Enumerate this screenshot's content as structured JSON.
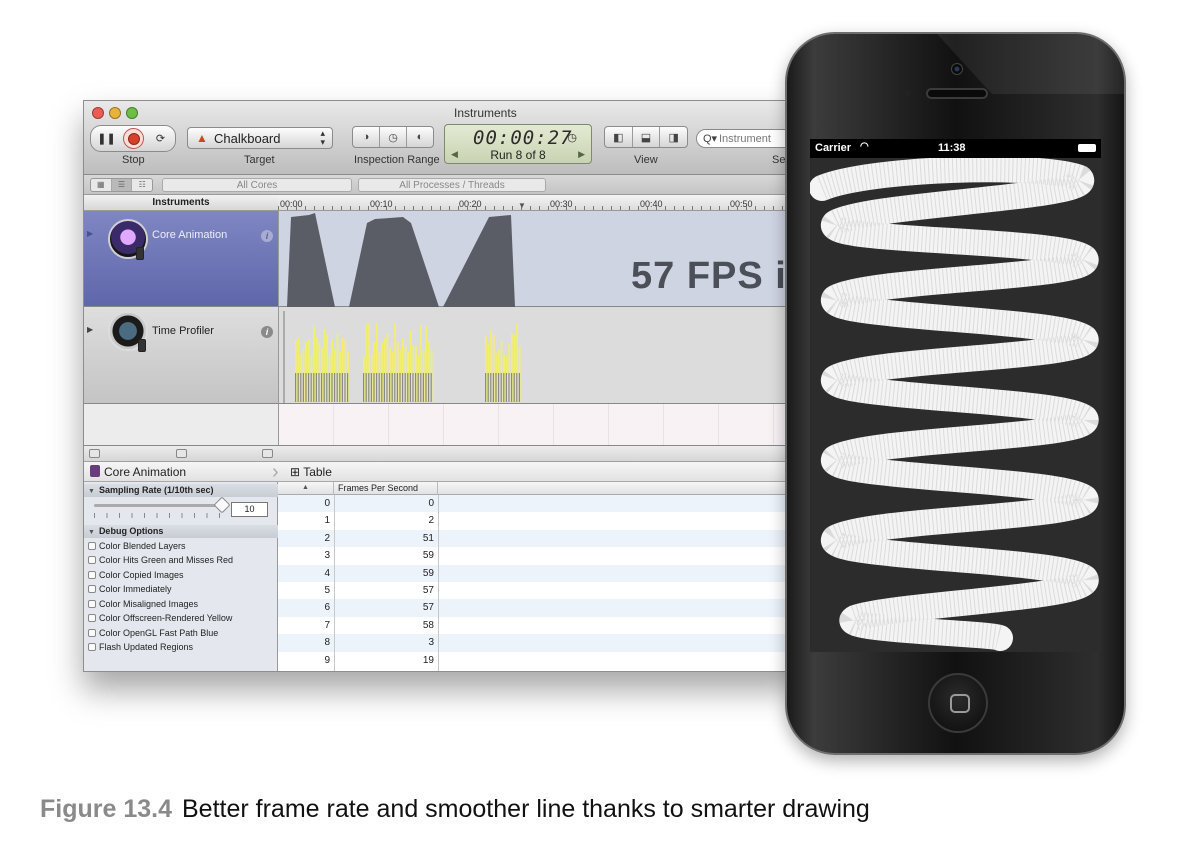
{
  "window": {
    "title": "Instruments",
    "toolbar": {
      "stop_label": "Stop",
      "target_label": "Target",
      "target_value": "Chalkboard",
      "inspection_label": "Inspection Range",
      "timer": "00:00:27",
      "run_status": "Run 8 of 8",
      "view_label": "View",
      "search_placeholder": "Instrument",
      "truncated_label": "Se"
    },
    "filter": {
      "cores": "All Cores",
      "processes": "All Processes / Threads"
    },
    "ruler": {
      "header": "Instruments",
      "ticks": [
        "00:00",
        "00:10",
        "00:20",
        "00:30",
        "00:40",
        "00:50"
      ]
    },
    "tracks": [
      {
        "name": "Core Animation",
        "overlay": "57 FPS i"
      },
      {
        "name": "Time Profiler"
      }
    ],
    "detail": {
      "breadcrumb_instrument": "Core Animation",
      "breadcrumb_view": "Table",
      "sampling_header": "Sampling Rate (1/10th sec)",
      "sampling_value": "10",
      "debug_header": "Debug Options",
      "debug_options": [
        "Color Blended Layers",
        "Color Hits Green and Misses Red",
        "Color Copied Images",
        "Color Immediately",
        "Color Misaligned Images",
        "Color Offscreen-Rendered Yellow",
        "Color OpenGL Fast Path Blue",
        "Flash Updated Regions"
      ],
      "table": {
        "sort_indicator": "▲",
        "column_header": "Frames Per Second",
        "rows": [
          {
            "index": "0",
            "fps": "0"
          },
          {
            "index": "1",
            "fps": "2"
          },
          {
            "index": "2",
            "fps": "51"
          },
          {
            "index": "3",
            "fps": "59"
          },
          {
            "index": "4",
            "fps": "59"
          },
          {
            "index": "5",
            "fps": "57"
          },
          {
            "index": "6",
            "fps": "57"
          },
          {
            "index": "7",
            "fps": "58"
          },
          {
            "index": "8",
            "fps": "3"
          },
          {
            "index": "9",
            "fps": "19"
          }
        ]
      }
    }
  },
  "phone": {
    "carrier": "Carrier",
    "time": "11:38"
  },
  "caption": {
    "figure": "Figure 13.4",
    "text": "Better frame rate and smoother line thanks to smarter drawing"
  },
  "colors": {
    "accent_track": "#6a70b3",
    "cpu_bar": "#f2f06a",
    "record": "#d5402b"
  },
  "icons": [
    "pause-icon",
    "record-icon",
    "loop-icon",
    "target-app-icon",
    "clock-icon",
    "search-icon",
    "info-icon",
    "table-icon",
    "wifi-icon",
    "battery-icon",
    "home-button-icon"
  ]
}
